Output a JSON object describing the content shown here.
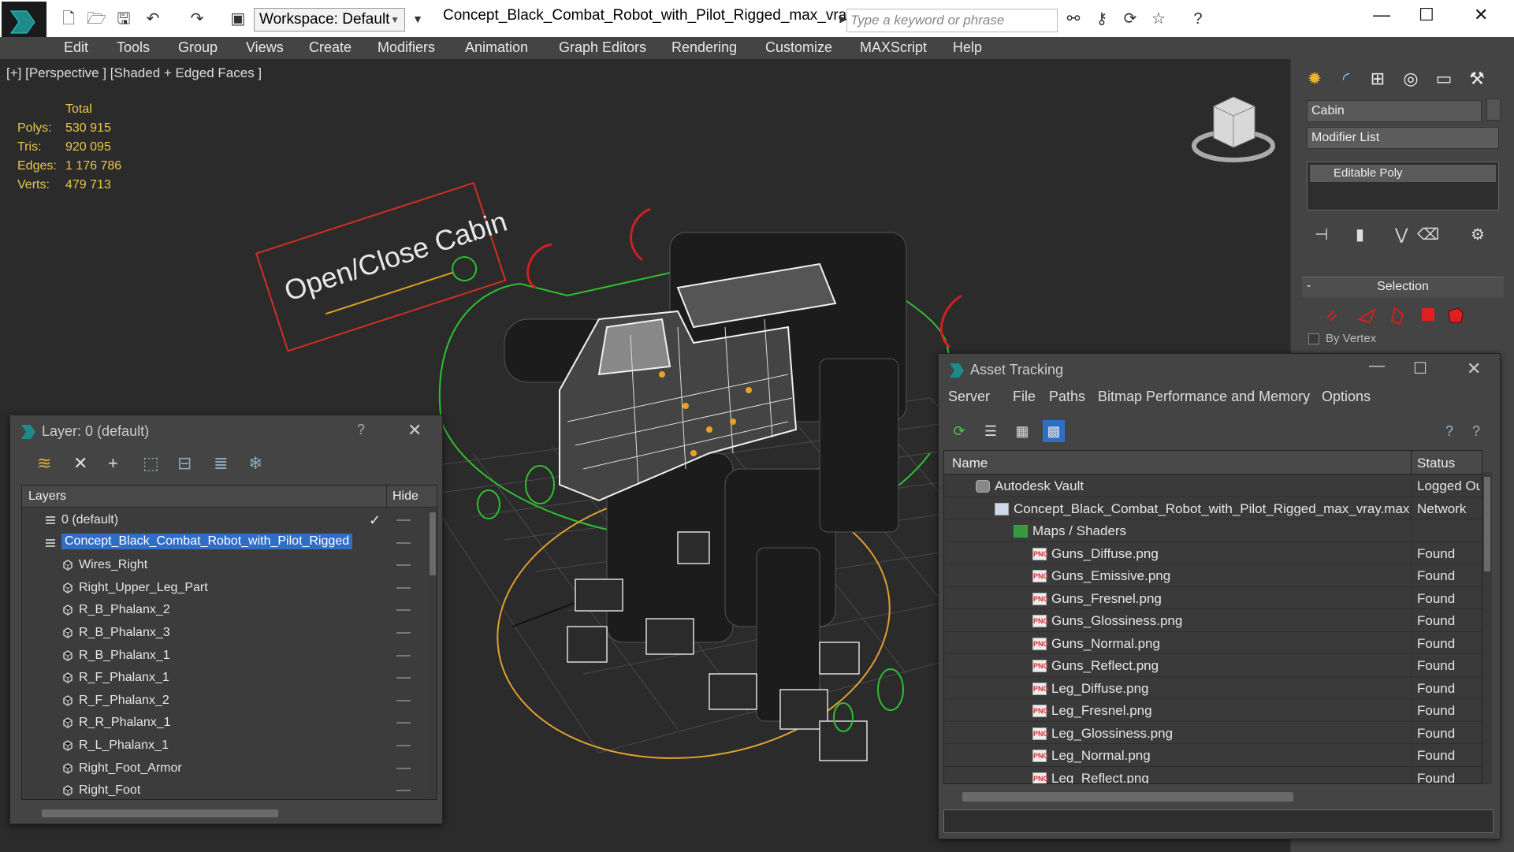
{
  "app": {
    "doc_title": "Concept_Black_Combat_Robot_with_Pilot_Rigged_max_vray...",
    "workspace_label": "Workspace: Default",
    "search_placeholder": "Type a keyword or phrase"
  },
  "menu": [
    "Edit",
    "Tools",
    "Group",
    "Views",
    "Create",
    "Modifiers",
    "Animation",
    "Graph Editors",
    "Rendering",
    "Customize",
    "MAXScript",
    "Help"
  ],
  "viewport": {
    "label": "[+] [Perspective ] [Shaded + Edged Faces ]",
    "stats_header": "Total",
    "stats": [
      {
        "k": "Polys:",
        "v": "530 915"
      },
      {
        "k": "Tris:",
        "v": "920 095"
      },
      {
        "k": "Edges:",
        "v": "1 176 786"
      },
      {
        "k": "Verts:",
        "v": "479 713"
      }
    ],
    "sign_text": "Open/Close Cabin"
  },
  "command_panel": {
    "object_name": "Cabin",
    "modifier_list": "Modifier List",
    "stack_item": "Editable Poly",
    "rollout_title": "Selection",
    "by_vertex": "By Vertex",
    "accent_color": "#e02020"
  },
  "layer_window": {
    "title": "Layer: 0 (default)",
    "help": "?",
    "col_layers": "Layers",
    "col_hide": "Hide",
    "rows": [
      {
        "label": "0 (default)",
        "level": 0,
        "type": "layer"
      },
      {
        "label": "Concept_Black_Combat_Robot_with_Pilot_Rigged",
        "level": 0,
        "type": "layer",
        "selected": true
      },
      {
        "label": "Wires_Right",
        "level": 1,
        "type": "object"
      },
      {
        "label": "Right_Upper_Leg_Part",
        "level": 1,
        "type": "object"
      },
      {
        "label": "R_B_Phalanx_2",
        "level": 1,
        "type": "object"
      },
      {
        "label": "R_B_Phalanx_3",
        "level": 1,
        "type": "object"
      },
      {
        "label": "R_B_Phalanx_1",
        "level": 1,
        "type": "object"
      },
      {
        "label": "R_F_Phalanx_1",
        "level": 1,
        "type": "object"
      },
      {
        "label": "R_F_Phalanx_2",
        "level": 1,
        "type": "object"
      },
      {
        "label": "R_R_Phalanx_1",
        "level": 1,
        "type": "object"
      },
      {
        "label": "R_L_Phalanx_1",
        "level": 1,
        "type": "object"
      },
      {
        "label": "Right_Foot_Armor",
        "level": 1,
        "type": "object"
      },
      {
        "label": "Right_Foot",
        "level": 1,
        "type": "object"
      }
    ]
  },
  "asset_window": {
    "title": "Asset Tracking",
    "menu": [
      "Server",
      "File",
      "Paths",
      "Bitmap Performance and Memory",
      "Options"
    ],
    "col_name": "Name",
    "col_status": "Status",
    "rows": [
      {
        "name": "Autodesk Vault",
        "status": "Logged Out",
        "level": 0,
        "icon": "vault-icon"
      },
      {
        "name": "Concept_Black_Combat_Robot_with_Pilot_Rigged_max_vray.max",
        "status": "Network",
        "level": 1,
        "icon": "max-file-icon"
      },
      {
        "name": "Maps / Shaders",
        "status": "",
        "level": 2,
        "icon": "maps-icon"
      },
      {
        "name": "Guns_Diffuse.png",
        "status": "Found",
        "level": 3,
        "icon": "png-icon"
      },
      {
        "name": "Guns_Emissive.png",
        "status": "Found",
        "level": 3,
        "icon": "png-icon"
      },
      {
        "name": "Guns_Fresnel.png",
        "status": "Found",
        "level": 3,
        "icon": "png-icon"
      },
      {
        "name": "Guns_Glossiness.png",
        "status": "Found",
        "level": 3,
        "icon": "png-icon"
      },
      {
        "name": "Guns_Normal.png",
        "status": "Found",
        "level": 3,
        "icon": "png-icon"
      },
      {
        "name": "Guns_Reflect.png",
        "status": "Found",
        "level": 3,
        "icon": "png-icon"
      },
      {
        "name": "Leg_Diffuse.png",
        "status": "Found",
        "level": 3,
        "icon": "png-icon"
      },
      {
        "name": "Leg_Fresnel.png",
        "status": "Found",
        "level": 3,
        "icon": "png-icon"
      },
      {
        "name": "Leg_Glossiness.png",
        "status": "Found",
        "level": 3,
        "icon": "png-icon"
      },
      {
        "name": "Leg_Normal.png",
        "status": "Found",
        "level": 3,
        "icon": "png-icon"
      },
      {
        "name": "Leg_Reflect.png",
        "status": "Found",
        "level": 3,
        "icon": "png-icon"
      }
    ]
  },
  "icon_text": {
    "png": "PNG",
    "min": "—",
    "max": "☐",
    "close": "✕",
    "minus": "-",
    "check": "✓"
  }
}
